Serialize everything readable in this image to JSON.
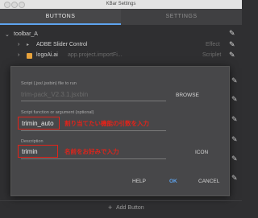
{
  "window": {
    "title": "KBar Settings"
  },
  "tabs": [
    {
      "label": "BUTTONS",
      "active": true
    },
    {
      "label": "SETTINGS",
      "active": false
    }
  ],
  "tree": {
    "toolbar_label": "toolbar_A",
    "items": [
      {
        "label": "ADBE Slider Control",
        "type": "Effect"
      },
      {
        "label": "logoAi.ai",
        "detail": "app.project.importFi...",
        "type": "Scriplet"
      }
    ]
  },
  "dialog": {
    "script": {
      "label": "Script (.jsx/.jsxbin) file to run",
      "value": "trim-pack_V2.3.1.jsxbin",
      "button": "BROWSE"
    },
    "argument": {
      "label": "Script function or argument (optional)",
      "value": "trimin_auto",
      "note": "割り当てたい機能の引数を入力"
    },
    "description": {
      "label": "Description",
      "value": "trimin",
      "note": "名前をお好みで入力",
      "button": "ICON"
    },
    "buttons": {
      "help": "HELP",
      "ok": "OK",
      "cancel": "CANCEL"
    }
  },
  "footer": {
    "add_button": "Add Button"
  },
  "colors": {
    "accent": "#5ea4ef",
    "annotation": "#e2231a"
  }
}
